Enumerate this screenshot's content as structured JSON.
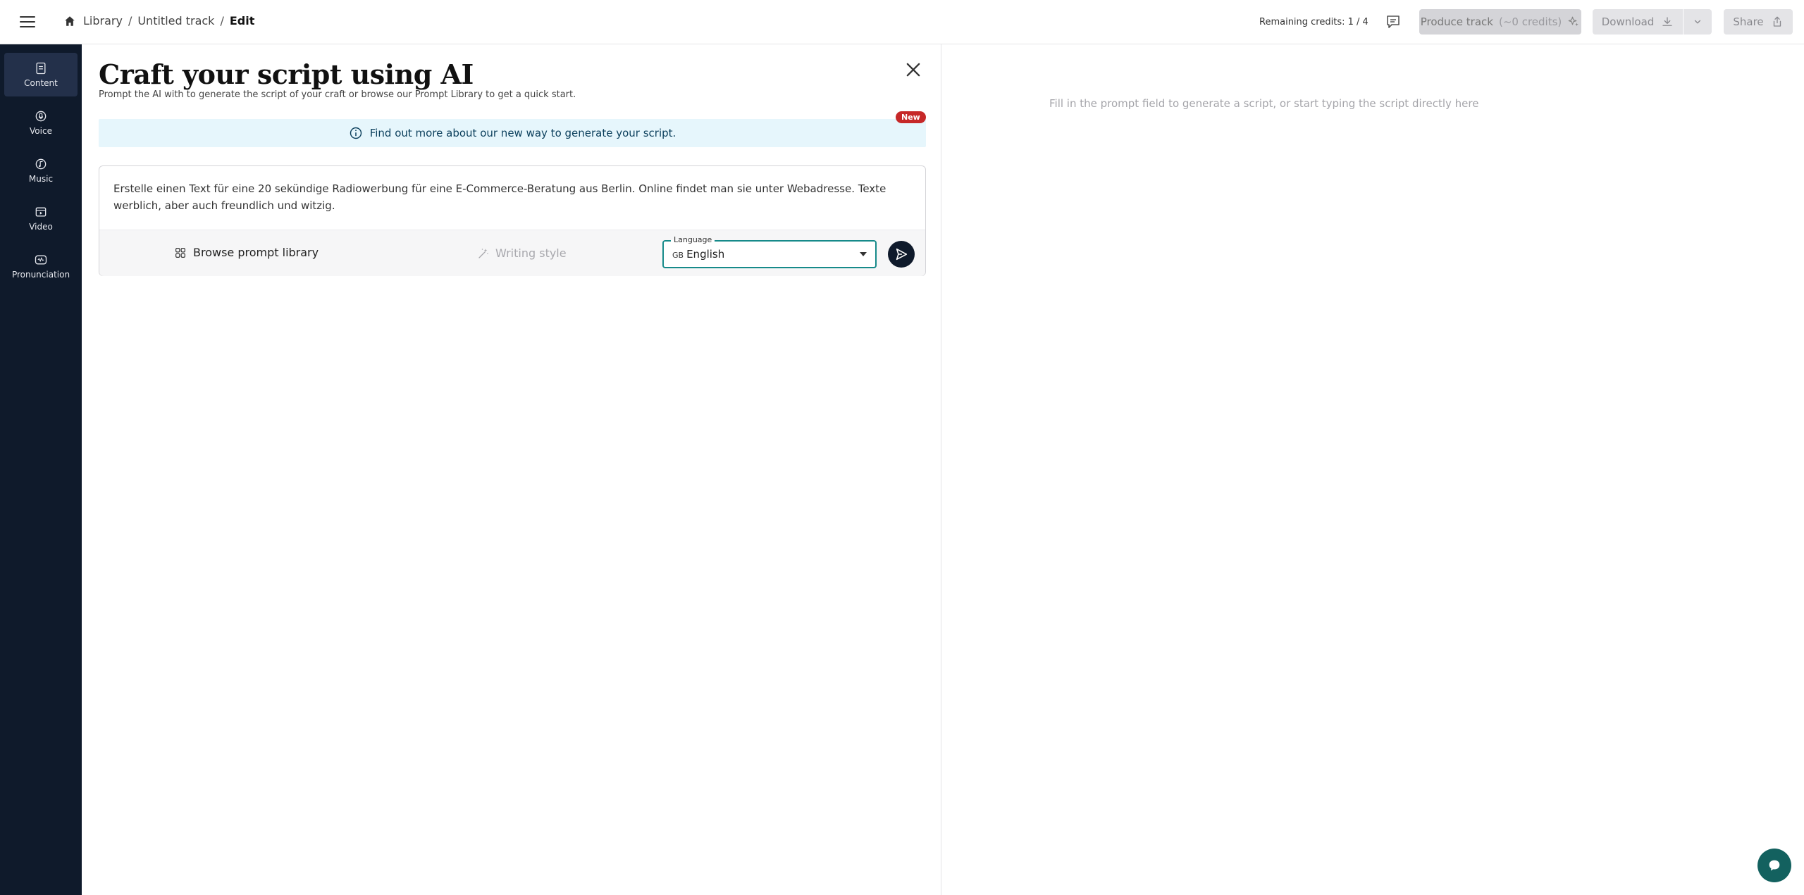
{
  "header": {
    "breadcrumb": {
      "library": "Library",
      "track": "Untitled track",
      "current": "Edit",
      "separator": "/"
    },
    "credits_label": "Remaining credits: 1 / 4",
    "produce": {
      "label": "Produce track",
      "credits": "(~0 credits)"
    },
    "download_label": "Download",
    "share_label": "Share"
  },
  "sidebar": {
    "items": [
      {
        "label": "Content",
        "icon": "document-icon",
        "active": true
      },
      {
        "label": "Voice",
        "icon": "microphone-icon",
        "active": false
      },
      {
        "label": "Music",
        "icon": "music-note-icon",
        "active": false
      },
      {
        "label": "Video",
        "icon": "video-icon",
        "active": false
      },
      {
        "label": "Pronunciation",
        "icon": "pronunciation-icon",
        "active": false
      }
    ]
  },
  "editor": {
    "title": "Craft your script using AI",
    "subtitle": "Prompt the AI with to generate the script of your craft or browse our Prompt Library to get a quick start.",
    "banner": {
      "text": "Find out more about our new way to generate your script.",
      "badge": "New"
    },
    "prompt": {
      "value": "Erstelle einen Text für eine 20 sekündige Radiowerbung für eine E-Commerce-Beratung aus Berlin. Online findet man sie unter Webadresse. Texte werblich, aber auch freundlich und witzig.",
      "browse_label": "Browse prompt library",
      "style_label": "Writing style",
      "language": {
        "label": "Language",
        "flag": "GB",
        "value": "English"
      }
    }
  },
  "script": {
    "placeholder": "Fill in the prompt field to generate a script, or start typing the script directly here"
  },
  "colors": {
    "sidebar_bg": "#0f1a2b",
    "accent_teal": "#168a8a",
    "banner_bg": "#e6f6fc",
    "badge_red": "#c62828"
  }
}
